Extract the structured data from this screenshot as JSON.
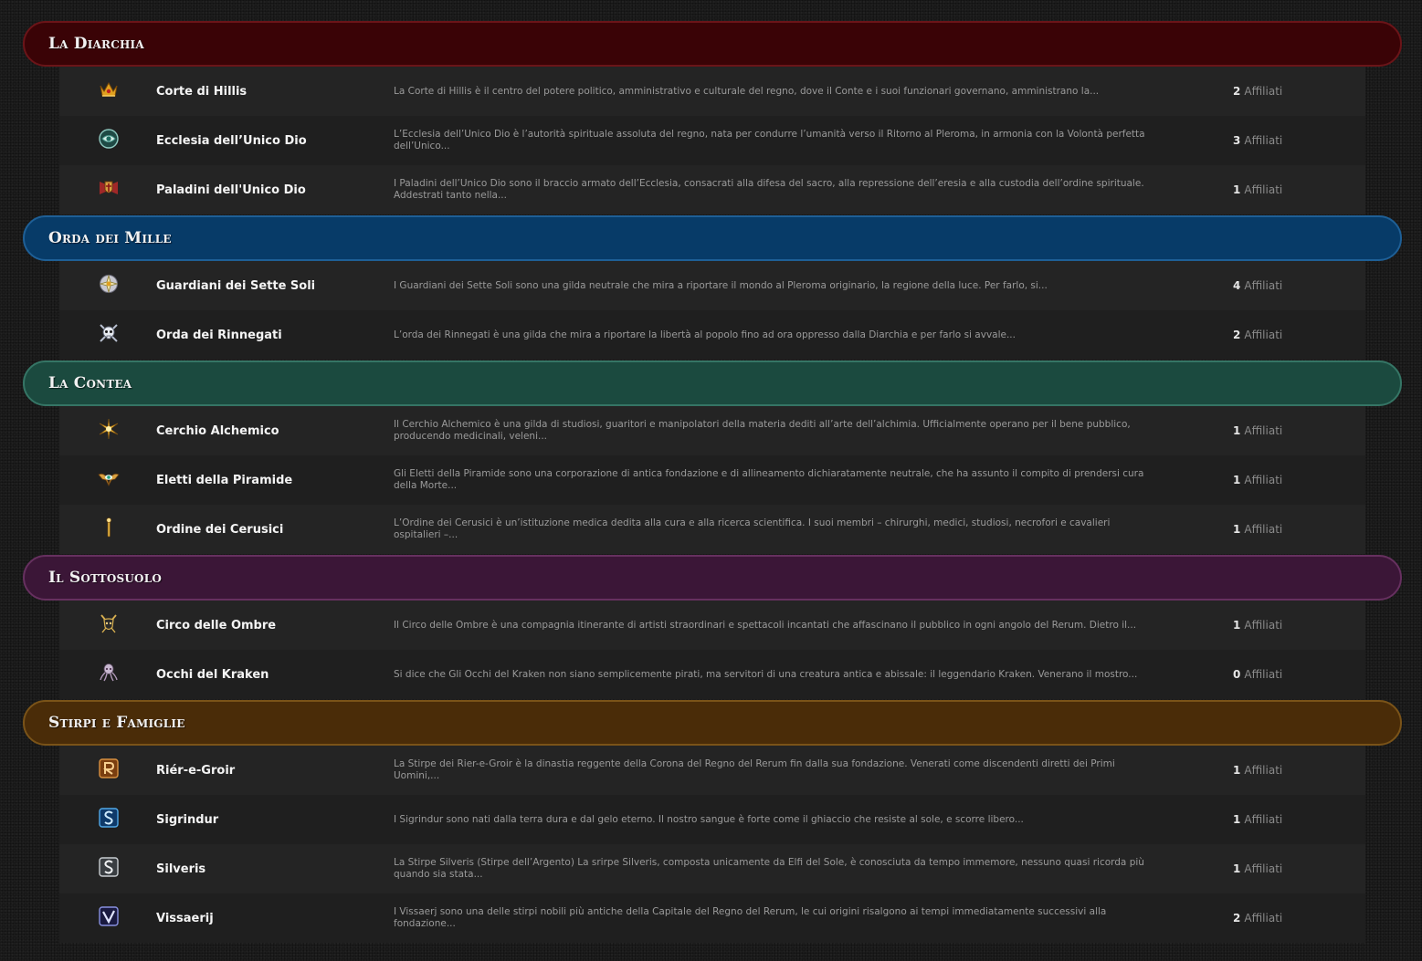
{
  "affiliates_label": "Affiliati",
  "sections": [
    {
      "title": "La Diarchia",
      "color": "#3a0306",
      "border": "#6b1418",
      "guilds": [
        {
          "name": "Corte di Hillis",
          "icon": "crown-icon",
          "description": "La Corte di Hillis è il centro del potere politico, amministrativo e culturale del regno, dove il Conte e i suoi funzionari governano, amministrano la...",
          "count": "2"
        },
        {
          "name": "Ecclesia dell’Unico Dio",
          "icon": "sacred-eye-icon",
          "description": "L’Ecclesia dell’Unico Dio è l’autorità spirituale assoluta del regno, nata per condurre l’umanità verso il Ritorno al Pleroma, in armonia con la Volontà perfetta dell’Unico...",
          "count": "3"
        },
        {
          "name": "Paladini dell'Unico Dio",
          "icon": "winged-shield-icon",
          "description": "I Paladini dell’Unico Dio sono il braccio armato dell’Ecclesia, consacrati alla difesa del sacro, alla repressione dell’eresia e alla custodia dell’ordine spirituale. Addestrati tanto nella...",
          "count": "1"
        }
      ]
    },
    {
      "title": "Orda dei Mille",
      "color": "#073b68",
      "border": "#1e5f96",
      "guilds": [
        {
          "name": "Guardiani dei Sette Soli",
          "icon": "sun-emblem-icon",
          "description": "I Guardiani dei Sette Soli sono una gilda neutrale che mira a riportare il mondo al Pleroma originario, la regione della luce. Per farlo, si...",
          "count": "4"
        },
        {
          "name": "Orda dei Rinnegati",
          "icon": "skull-crossed-blades-icon",
          "description": "L’orda dei Rinnegati è una gilda che mira a riportare la libertà al popolo fino ad ora oppresso dalla Diarchia e per farlo si avvale...",
          "count": "2"
        }
      ]
    },
    {
      "title": "La Contea",
      "color": "#1b4a3f",
      "border": "#357565",
      "guilds": [
        {
          "name": "Cerchio Alchemico",
          "icon": "radiant-star-icon",
          "description": "Il Cerchio Alchemico è una gilda di studiosi, guaritori e manipolatori della materia dediti all’arte dell’alchimia. Ufficialmente operano per il bene pubblico, producendo medicinali, veleni...",
          "count": "1"
        },
        {
          "name": "Eletti della Piramide",
          "icon": "winged-eye-icon",
          "description": "Gli Eletti della Piramide sono una corporazione di antica fondazione e di allineamento dichiaratamente neutrale, che ha assunto il compito di prendersi cura della Morte...",
          "count": "1"
        },
        {
          "name": "Ordine dei Cerusici",
          "icon": "staff-icon",
          "description": "L’Ordine dei Cerusici è un’istituzione medica dedita alla cura e alla ricerca scientifica. I suoi membri – chirurghi, medici, studiosi, necrofori e cavalieri ospitalieri –...",
          "count": "1"
        }
      ]
    },
    {
      "title": "Il Sottosuolo",
      "color": "#3b1637",
      "border": "#66305f",
      "guilds": [
        {
          "name": "Circo delle Ombre",
          "icon": "jester-mask-icon",
          "description": "Il Circo delle Ombre è una compagnia itinerante di artisti straordinari e spettacoli incantati che affascinano il pubblico in ogni angolo del Rerum. Dietro il...",
          "count": "1"
        },
        {
          "name": "Occhi del Kraken",
          "icon": "kraken-icon",
          "description": "Si dice che Gli Occhi del Kraken non siano semplicemente pirati, ma servitori di una creatura antica e abissale: il leggendario Kraken. Venerano il mostro...",
          "count": "0"
        }
      ]
    },
    {
      "title": "Stirpi e Famiglie",
      "color": "#4a2c08",
      "border": "#7a5318",
      "guilds": [
        {
          "name": "Riér-e-Groir",
          "icon": "rune-r-icon",
          "description": "La Stirpe dei Rier-e-Groir è la dinastia reggente della Corona del Regno del Rerum fin dalla sua fondazione. Venerati come discendenti diretti dei Primi Uomini,...",
          "count": "1"
        },
        {
          "name": "Sigrindur",
          "icon": "rune-s-blue-icon",
          "description": "I Sigrindur sono nati dalla terra dura e dal gelo eterno. Il nostro sangue è forte come il ghiaccio che resiste al sole, e scorre libero...",
          "count": "1"
        },
        {
          "name": "Silveris",
          "icon": "rune-s-silver-icon",
          "description": "La Stirpe Silveris (Stirpe dell’Argento) La srirpe Silveris, composta unicamente da Elfi del Sole, è conosciuta da tempo immemore, nessuno quasi ricorda più quando sia stata...",
          "count": "1"
        },
        {
          "name": "Vissaerij",
          "icon": "rune-v-icon",
          "description": "I Vissaerj sono una delle stirpi nobili più antiche della Capitale del Regno del Rerum, le cui origini risalgono ai tempi immediatamente successivi alla fondazione...",
          "count": "2"
        }
      ]
    }
  ]
}
